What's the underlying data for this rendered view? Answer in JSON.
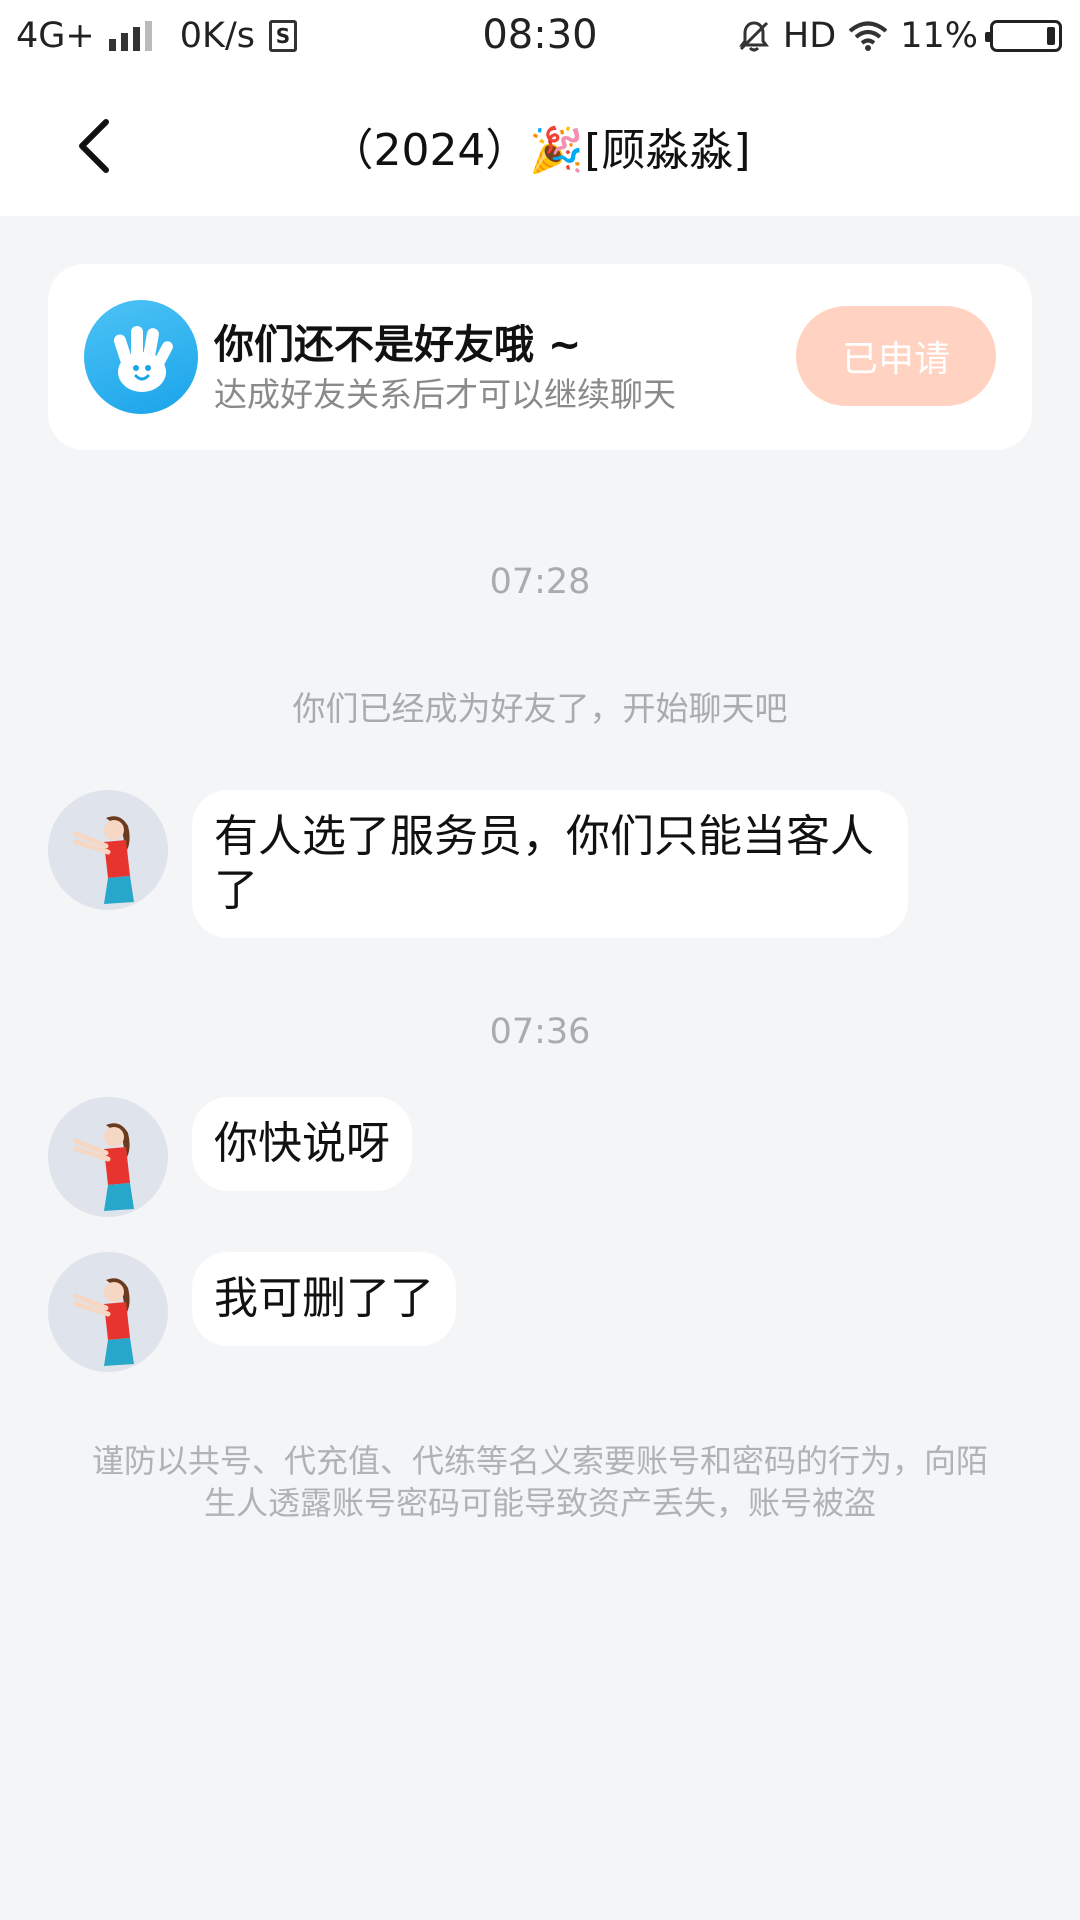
{
  "status_bar": {
    "network": "4G+",
    "speed": "0K/s",
    "sd_icon": "S",
    "time": "08:30",
    "hd": "HD",
    "battery": "11%"
  },
  "nav": {
    "title": "（2024）🎉[顾淼淼]"
  },
  "friend_card": {
    "title": "你们还不是好友哦 ~",
    "subtitle": "达成好友关系后才可以继续聊天",
    "button": "已申请"
  },
  "chat": {
    "time1": "07:28",
    "system_message": "你们已经成为好友了，开始聊天吧",
    "message1": "有人选了服务员，你们只能当客人了",
    "time2": "07:36",
    "message2": "你快说呀",
    "message3": "我可删了了"
  },
  "warning": "谨防以共号、代充值、代练等名义索要账号和密码的行为，向陌生人透露账号密码可能导致资产丢失，账号被盗",
  "colors": {
    "background": "#f4f5f7",
    "apply_button": "#ffd2c1",
    "avatar_accent": "#1aa4ea"
  }
}
